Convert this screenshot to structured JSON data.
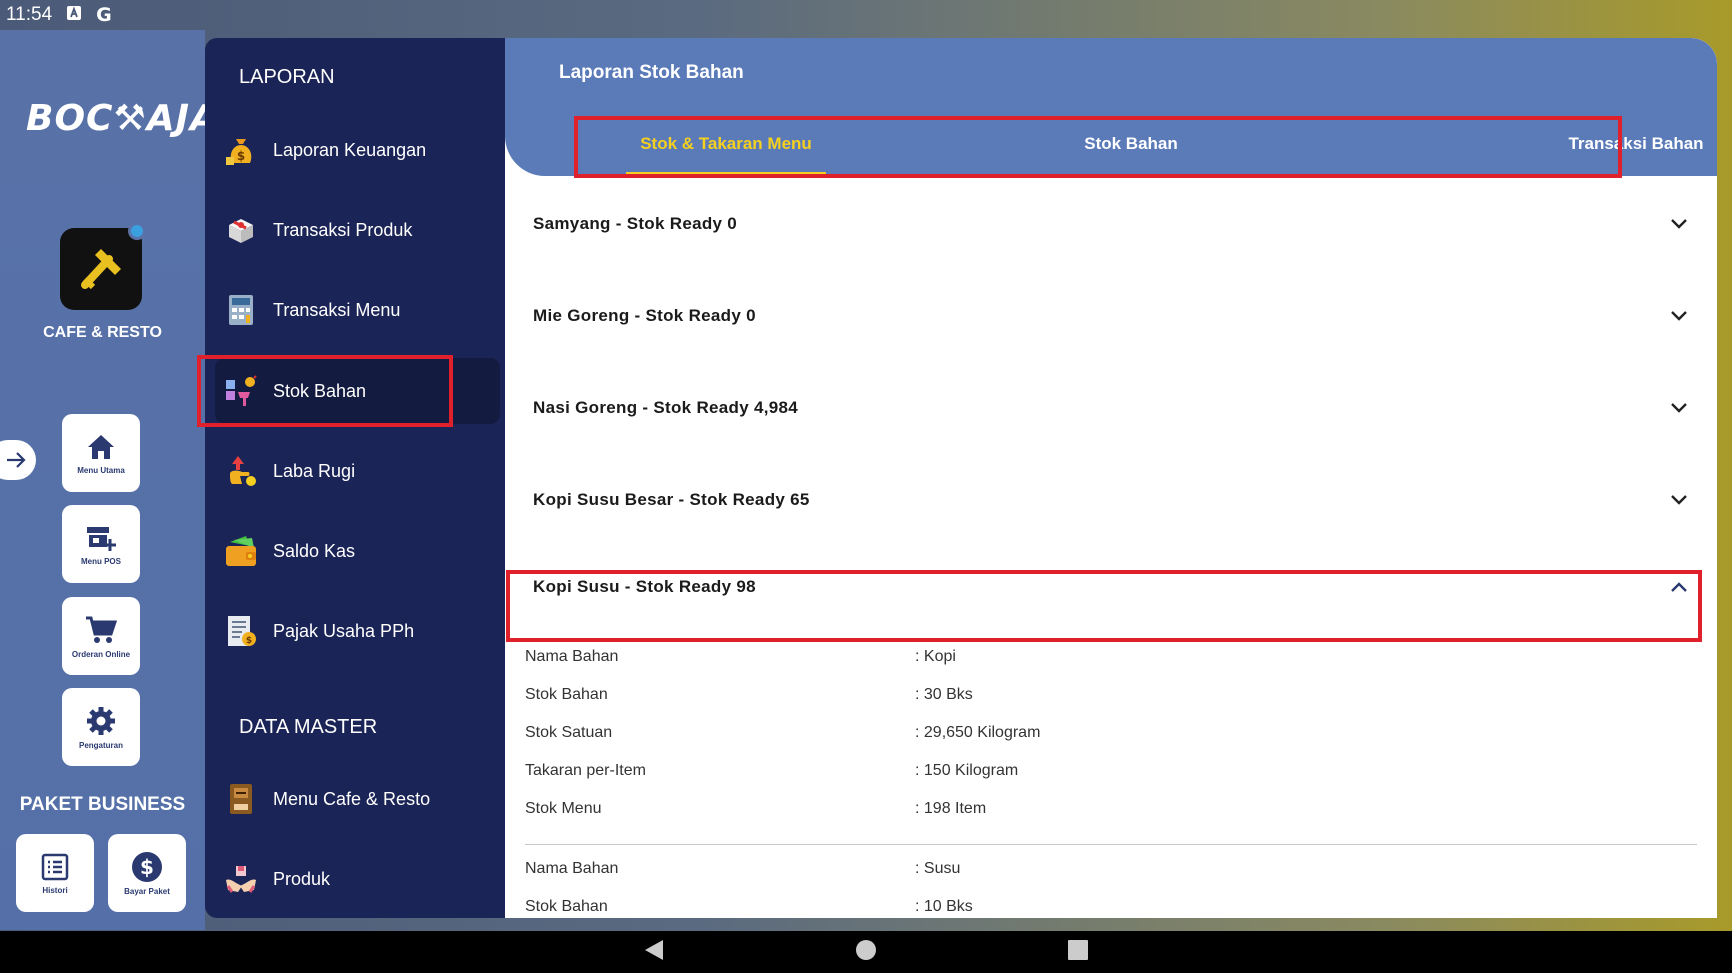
{
  "status": {
    "time": "11:54"
  },
  "rail": {
    "logo_text": "BOC⚒AJA",
    "app_label": "CAFE & RESTO",
    "buttons": [
      {
        "label": "Menu Utama",
        "icon": "home-icon"
      },
      {
        "label": "Menu POS",
        "icon": "store-add-icon"
      },
      {
        "label": "Orderan Online",
        "icon": "cart-icon"
      },
      {
        "label": "Pengaturan",
        "icon": "gear-icon"
      }
    ],
    "paket_title": "PAKET BUSINESS",
    "paket_buttons": [
      {
        "label": "Histori",
        "icon": "list-icon"
      },
      {
        "label": "Bayar Paket",
        "icon": "dollar-icon"
      }
    ]
  },
  "nav": {
    "laporan_title": "LAPORAN",
    "laporan_items": [
      {
        "label": "Laporan Keuangan",
        "icon": "money-bag-icon"
      },
      {
        "label": "Transaksi Produk",
        "icon": "box-icon"
      },
      {
        "label": "Transaksi Menu",
        "icon": "calculator-icon"
      },
      {
        "label": "Stok Bahan",
        "icon": "stock-icon",
        "active": true
      },
      {
        "label": "Laba Rugi",
        "icon": "profit-icon"
      },
      {
        "label": "Saldo Kas",
        "icon": "wallet-icon"
      },
      {
        "label": "Pajak Usaha PPh",
        "icon": "tax-icon"
      }
    ],
    "master_title": "DATA MASTER",
    "master_items": [
      {
        "label": "Menu Cafe & Resto",
        "icon": "menu-book-icon"
      },
      {
        "label": "Produk",
        "icon": "product-hand-icon"
      }
    ]
  },
  "main": {
    "title": "Laporan Stok Bahan",
    "tabs": [
      "Stok & Takaran Menu",
      "Stok Bahan",
      "Transaksi Bahan"
    ],
    "active_tab": 0,
    "accordions": [
      {
        "title": "Samyang - Stok Ready 0",
        "expanded": false
      },
      {
        "title": "Mie Goreng - Stok Ready 0",
        "expanded": false
      },
      {
        "title": "Nasi Goreng - Stok Ready 4,984",
        "expanded": false
      },
      {
        "title": "Kopi Susu Besar - Stok Ready 65",
        "expanded": false
      },
      {
        "title": "Kopi Susu - Stok Ready 98",
        "expanded": true
      }
    ],
    "details": [
      [
        {
          "k": "Nama Bahan",
          "v": ": Kopi"
        },
        {
          "k": "Stok Bahan",
          "v": ": 30 Bks"
        },
        {
          "k": "Stok Satuan",
          "v": ": 29,650 Kilogram"
        },
        {
          "k": "Takaran per-Item",
          "v": ": 150 Kilogram"
        },
        {
          "k": "Stok Menu",
          "v": ": 198 Item"
        }
      ],
      [
        {
          "k": "Nama Bahan",
          "v": ": Susu"
        },
        {
          "k": "Stok Bahan",
          "v": ": 10 Bks"
        }
      ]
    ]
  },
  "colors": {
    "accent": "#f5d020",
    "nav_bg": "#1b2456",
    "header_bg": "#5a7ab8",
    "highlight": "#e0202a"
  }
}
